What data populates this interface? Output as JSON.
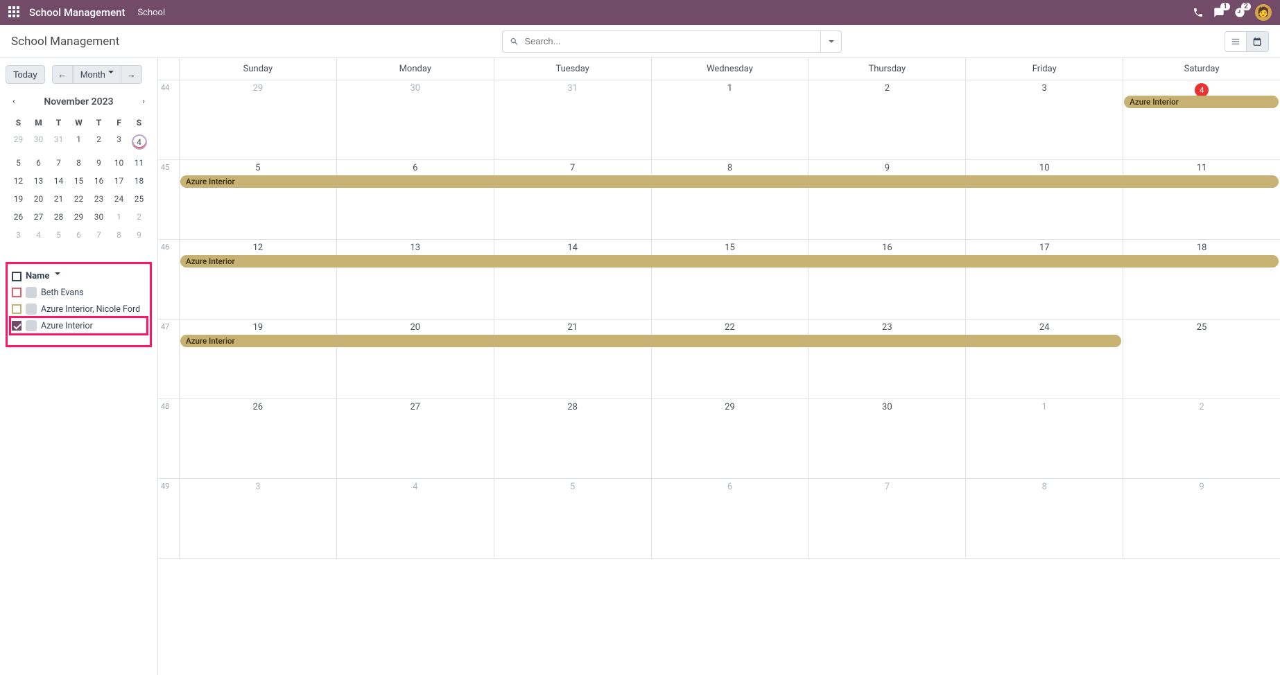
{
  "topbar": {
    "app_title": "School Management",
    "breadcrumb": "School",
    "msg_badge": "1",
    "activity_badge": "2"
  },
  "controlbar": {
    "title": "School Management",
    "search_placeholder": "Search..."
  },
  "sidebar": {
    "today_label": "Today",
    "range_label": "Month",
    "mini_title": "November 2023",
    "dow": [
      "S",
      "M",
      "T",
      "W",
      "T",
      "F",
      "S"
    ],
    "today_day": "4"
  },
  "filters": {
    "head_label": "Name",
    "items": [
      {
        "label": "Beth Evans",
        "checked": false,
        "color": "red"
      },
      {
        "label": "Azure Interior, Nicole Ford",
        "checked": false,
        "color": "tan"
      },
      {
        "label": "Azure Interior",
        "checked": true,
        "color": "checked"
      }
    ]
  },
  "calendar": {
    "dow": [
      "Sunday",
      "Monday",
      "Tuesday",
      "Wednesday",
      "Thursday",
      "Friday",
      "Saturday"
    ],
    "event_label": "Azure Interior",
    "weeks": [
      {
        "num": "44",
        "days": [
          "29",
          "30",
          "31",
          "1",
          "2",
          "3",
          "4"
        ],
        "muted": [
          0,
          1,
          2
        ],
        "today": 6,
        "ev_start": 6,
        "ev_end": 7
      },
      {
        "num": "45",
        "days": [
          "5",
          "6",
          "7",
          "8",
          "9",
          "10",
          "11"
        ],
        "muted": [],
        "ev_start": 0,
        "ev_end": 7
      },
      {
        "num": "46",
        "days": [
          "12",
          "13",
          "14",
          "15",
          "16",
          "17",
          "18"
        ],
        "muted": [],
        "ev_start": 0,
        "ev_end": 7
      },
      {
        "num": "47",
        "days": [
          "19",
          "20",
          "21",
          "22",
          "23",
          "24",
          "25"
        ],
        "muted": [],
        "ev_start": 0,
        "ev_end": 6
      },
      {
        "num": "48",
        "days": [
          "26",
          "27",
          "28",
          "29",
          "30",
          "1",
          "2"
        ],
        "muted": [
          5,
          6
        ]
      },
      {
        "num": "49",
        "days": [
          "3",
          "4",
          "5",
          "6",
          "7",
          "8",
          "9"
        ],
        "muted": [
          0,
          1,
          2,
          3,
          4,
          5,
          6
        ]
      }
    ]
  },
  "mini_weeks": [
    {
      "days": [
        "29",
        "30",
        "31",
        "1",
        "2",
        "3",
        "4"
      ],
      "muted": [
        0,
        1,
        2
      ],
      "today": 6
    },
    {
      "days": [
        "5",
        "6",
        "7",
        "8",
        "9",
        "10",
        "11"
      ],
      "muted": []
    },
    {
      "days": [
        "12",
        "13",
        "14",
        "15",
        "16",
        "17",
        "18"
      ],
      "muted": []
    },
    {
      "days": [
        "19",
        "20",
        "21",
        "22",
        "23",
        "24",
        "25"
      ],
      "muted": []
    },
    {
      "days": [
        "26",
        "27",
        "28",
        "29",
        "30",
        "1",
        "2"
      ],
      "muted": [
        5,
        6
      ]
    },
    {
      "days": [
        "3",
        "4",
        "5",
        "6",
        "7",
        "8",
        "9"
      ],
      "muted": [
        0,
        1,
        2,
        3,
        4,
        5,
        6
      ]
    }
  ]
}
